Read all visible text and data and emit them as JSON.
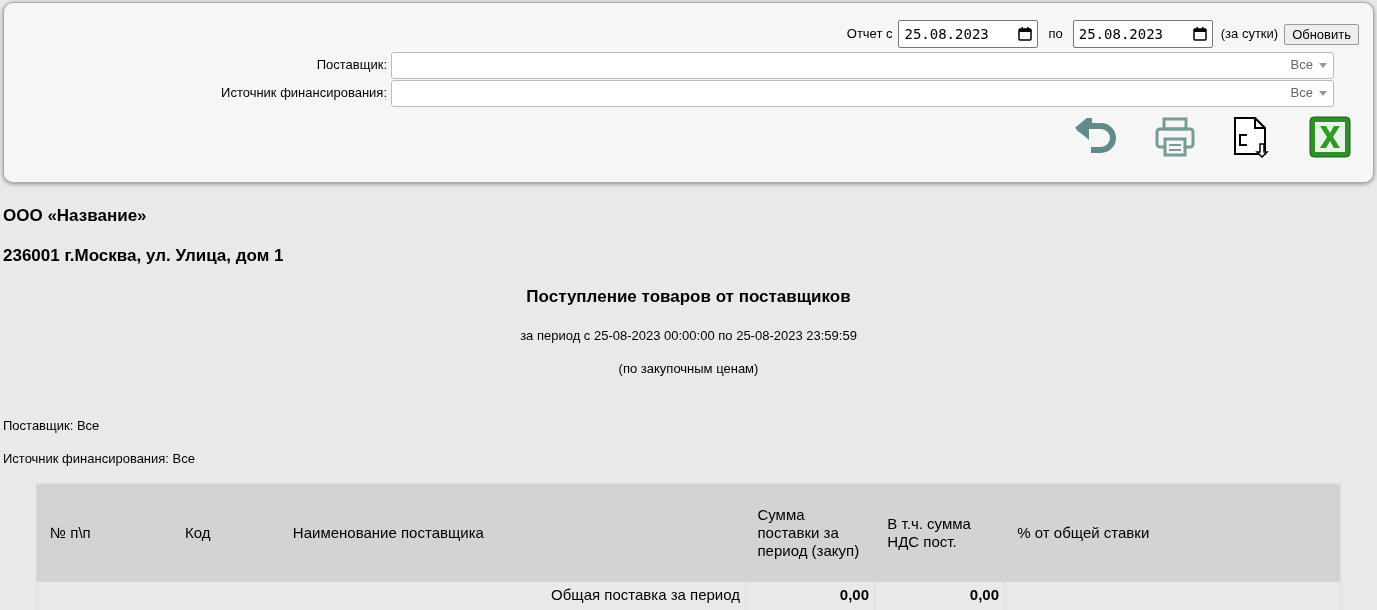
{
  "filters": {
    "date_from_label": "Отчет с",
    "date_from": "25.08.2023",
    "date_to_label": "по",
    "date_to": "25.08.2023",
    "period_note": "(за сутки)",
    "refresh_button": "Обновить",
    "selects": [
      {
        "label": "Поставщик:",
        "value": "Все"
      },
      {
        "label": "Источник финансирования:",
        "value": "Все"
      }
    ]
  },
  "report": {
    "company": "ООО «Название»",
    "address": "236001 г.Москва, ул. Улица, дом 1",
    "title": "Поступление товаров от поставщиков",
    "period": "за период с 25-08-2023 00:00:00 по 25-08-2023 23:59:59",
    "price_note": "(по закупочным ценам)",
    "params": [
      "Поставщик: Все",
      "Источник финансирования: Все"
    ]
  },
  "table": {
    "columns": [
      "№ п\\п",
      "Код",
      "Наименование поставщика",
      "Сумма поставки за период (закуп)",
      "В т.ч. сумма НДС пост.",
      "% от общей ставки"
    ],
    "total_row": {
      "label": "Общая поставка за период",
      "sum": "0,00",
      "vat": "0,00"
    }
  }
}
